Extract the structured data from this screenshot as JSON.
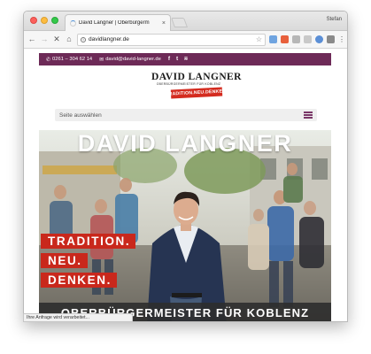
{
  "browser": {
    "tab_title": "David Langner | Oberbürgerm",
    "tab_close": "×",
    "profile_name": "Stefan",
    "url": "davidlangner.de",
    "status_text": "Ihre Anfrage wird verarbeitet..."
  },
  "site": {
    "topbar": {
      "background": "#6d2a57",
      "phone": "0261 – 304 62 14",
      "phone_icon": "phone-icon",
      "email": "david@david-langner.de",
      "email_icon": "mail-icon",
      "social": [
        {
          "icon": "facebook-icon",
          "glyph": "f"
        },
        {
          "icon": "twitter-icon",
          "glyph": "t"
        },
        {
          "icon": "rss-icon",
          "glyph": "⩳"
        }
      ]
    },
    "logo": {
      "name": "DAVID LANGNER",
      "subtitle": "OBERBÜRGERMEISTER FÜR KOBLENZ",
      "tagline": "TRADITION.NEU.DENKEN.",
      "tagline_color": "#d42b1f"
    },
    "menu": {
      "label": "Seite auswählen",
      "icon_color": "#7a3768"
    },
    "hero": {
      "name": "DAVID LANGNER",
      "slogan": [
        "TRADITION.",
        "NEU.",
        "DENKEN."
      ],
      "slogan_color": "#c9281c",
      "footer": "OBERBÜRGERMEISTER FÜR KOBLENZ"
    }
  }
}
